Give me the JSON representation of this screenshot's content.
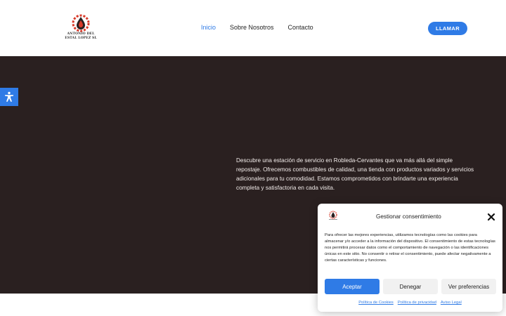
{
  "header": {
    "logo_text": "ANTONIO DEL ESTAL LOPEZ SL",
    "nav": [
      {
        "label": "Inicio",
        "active": true
      },
      {
        "label": "Sobre Nosotros",
        "active": false
      },
      {
        "label": "Contacto",
        "active": false
      }
    ],
    "call_label": "LLAMAR"
  },
  "hero": {
    "description": "Descubre una estación de servicio en Robleda-Cervantes que va más allá del simple repostaje. Ofrecemos combustibles de calidad, una tienda con productos variados y servicios adicionales para tu comodidad. Estamos comprometidos con brindarte una experiencia completa y satisfactoria en cada visita."
  },
  "accessibility": {
    "icon": "accessibility-icon"
  },
  "consent": {
    "title": "Gestionar consentimiento",
    "body": "Para ofrecer las mejores experiencias, utilizamos tecnologías como las cookies para almacenar y/o acceder a la información del dispositivo. El consentimiento de estas tecnologías nos permitirá procesar datos como el comportamiento de navegación o las identificaciones únicas en este sitio. No consentir o retirar el consentimiento, puede afectar negativamente a ciertas características y funciones.",
    "accept_label": "Aceptar",
    "deny_label": "Denegar",
    "prefs_label": "Ver preferencias",
    "links": [
      "Política de Cookies",
      "Política de privacidad",
      "Aviso Legal"
    ]
  },
  "colors": {
    "accent": "#2f7be6",
    "hero_bg": "#2a2020",
    "logo_red": "#d83a2a"
  }
}
